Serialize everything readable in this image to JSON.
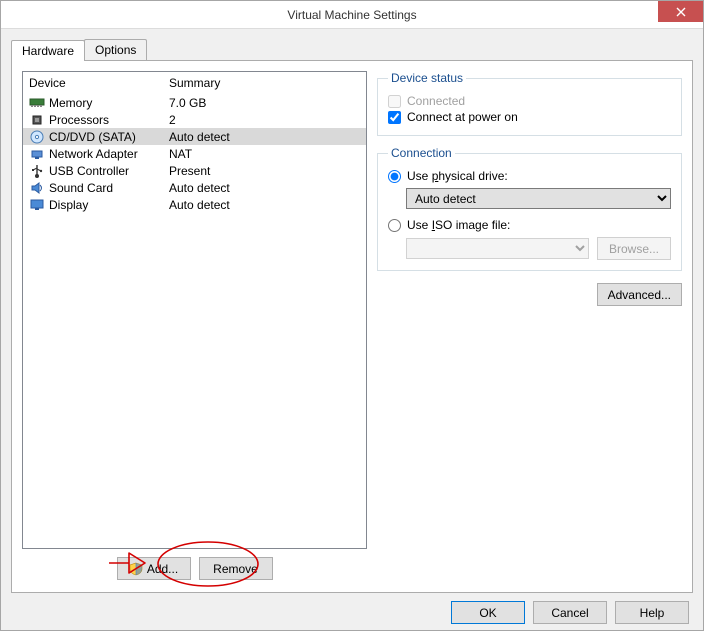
{
  "window": {
    "title": "Virtual Machine Settings"
  },
  "tabs": {
    "hardware": "Hardware",
    "options": "Options"
  },
  "deviceList": {
    "colDevice": "Device",
    "colSummary": "Summary",
    "rows": [
      {
        "name": "Memory",
        "summary": "7.0 GB"
      },
      {
        "name": "Processors",
        "summary": "2"
      },
      {
        "name": "CD/DVD (SATA)",
        "summary": "Auto detect"
      },
      {
        "name": "Network Adapter",
        "summary": "NAT"
      },
      {
        "name": "USB Controller",
        "summary": "Present"
      },
      {
        "name": "Sound Card",
        "summary": "Auto detect"
      },
      {
        "name": "Display",
        "summary": "Auto detect"
      }
    ]
  },
  "buttons": {
    "add": "Add...",
    "remove": "Remove",
    "browse": "Browse...",
    "advanced": "Advanced...",
    "ok": "OK",
    "cancel": "Cancel",
    "help": "Help"
  },
  "deviceStatus": {
    "legend": "Device status",
    "connected": "Connected",
    "connectAtPowerOn": "Connect at power on"
  },
  "connection": {
    "legend": "Connection",
    "usePhysical_pre": "Use ",
    "usePhysical_u": "p",
    "usePhysical_post": "hysical drive:",
    "physicalDriveValue": "Auto detect",
    "useIso_pre": "Use ",
    "useIso_u": "I",
    "useIso_post": "SO image file:",
    "isoPath": ""
  },
  "icons": {
    "memory": "mem",
    "processors": "cpu",
    "cd": "disc",
    "net": "net",
    "usb": "usb",
    "sound": "snd",
    "display": "disp"
  },
  "selectedRow": 2
}
